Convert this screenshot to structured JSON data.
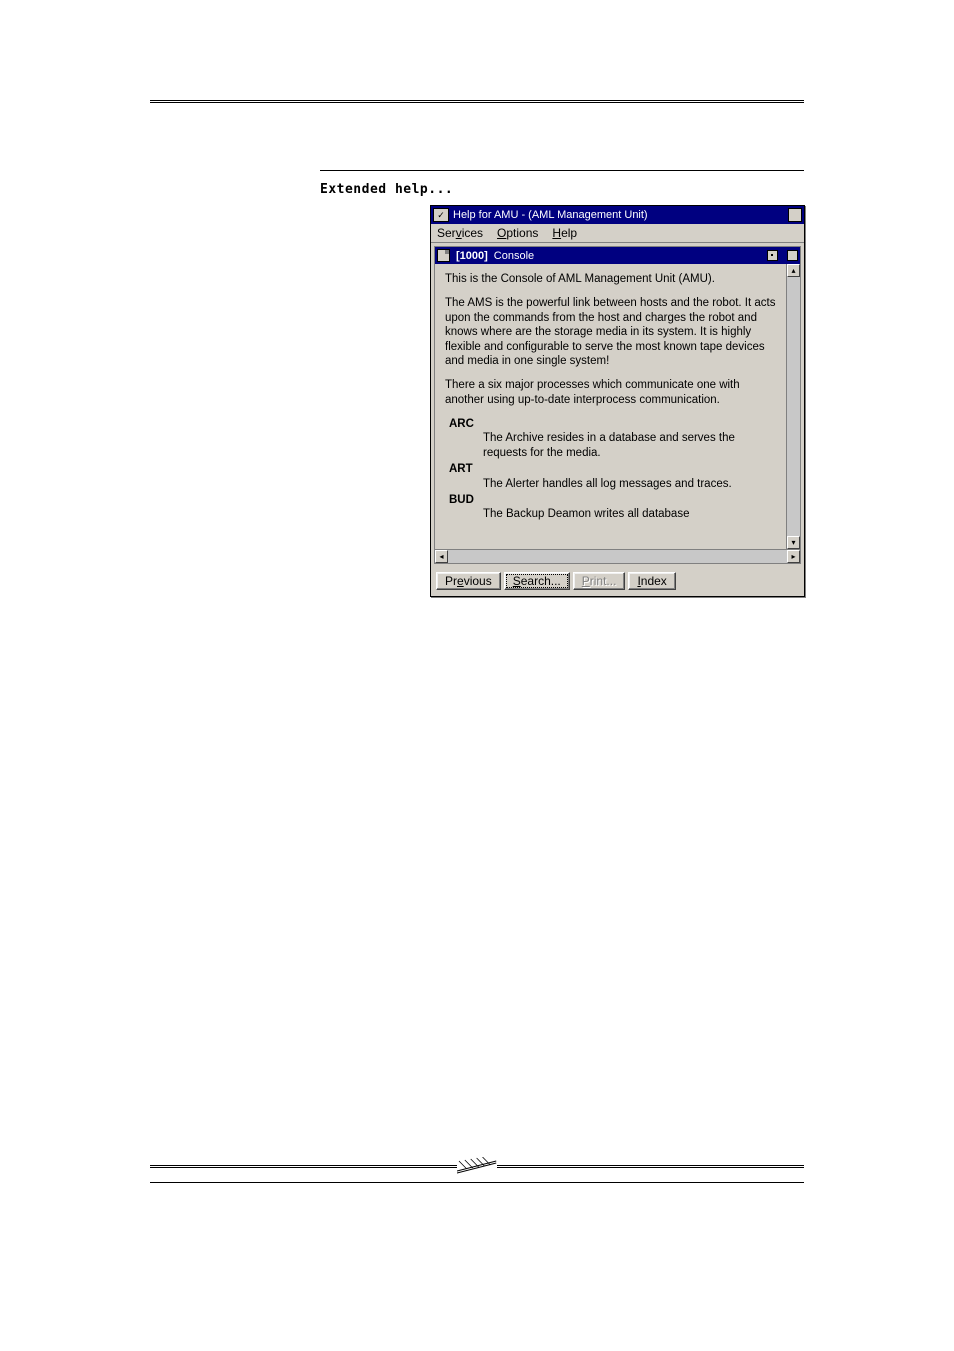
{
  "sidebar": {
    "heading": "Extended help..."
  },
  "window": {
    "title": "Help for AMU - (AML Management Unit)",
    "menubar": [
      {
        "pre": "Ser",
        "u": "v",
        "post": "ices"
      },
      {
        "pre": "",
        "u": "O",
        "post": "ptions"
      },
      {
        "pre": "",
        "u": "H",
        "post": "elp"
      }
    ],
    "content_title": {
      "id": "[1000]",
      "label": "Console"
    },
    "body": {
      "intro": "This is the Console of AML Management Unit (AMU).",
      "para1": "The AMS is the powerful link between hosts and the robot. It acts upon the commands from the host and charges the robot and knows where are the storage media in its system. It is highly flexible and configurable to serve the most known tape devices and media in one single system!",
      "para2": "There a six major processes which communicate one with another using up-to-date interprocess communication.",
      "defs": [
        {
          "term": "ARC",
          "desc": "The Archive resides in a database and serves the requests for the media."
        },
        {
          "term": "ART",
          "desc": "The Alerter handles all log messages and traces."
        },
        {
          "term": "BUD",
          "desc": "The Backup Deamon writes all database"
        }
      ]
    },
    "buttons": {
      "previous": {
        "pre": "Pr",
        "u": "e",
        "post": "vious"
      },
      "search": {
        "pre": "",
        "u": "S",
        "post": "earch..."
      },
      "print": {
        "pre": "",
        "u": "P",
        "post": "rint..."
      },
      "index": {
        "pre": "",
        "u": "I",
        "post": "ndex"
      }
    }
  }
}
